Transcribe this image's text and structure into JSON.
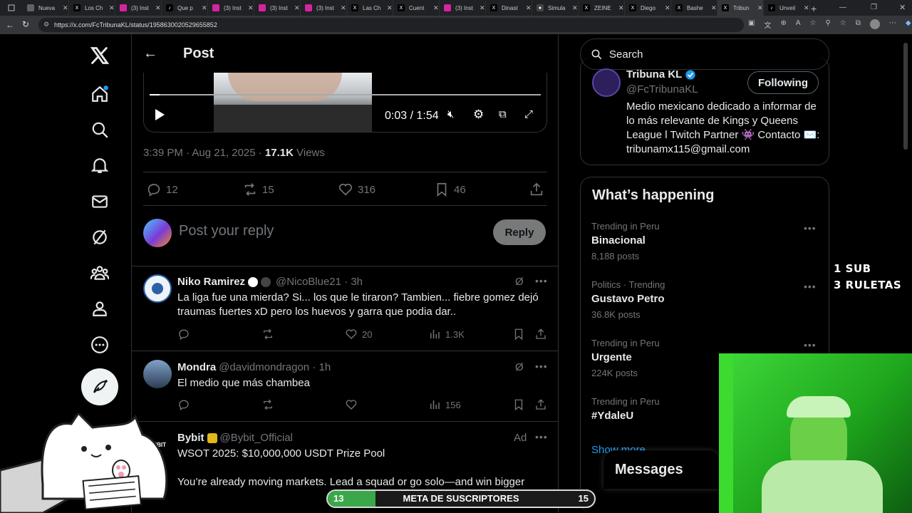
{
  "browser": {
    "tabs": [
      {
        "label": "Nueva",
        "color": "#5f6368",
        "glyph": ""
      },
      {
        "label": "Los Ch",
        "color": "#000000",
        "glyph": "X"
      },
      {
        "label": "(3) Inst",
        "color": "#d6249f",
        "glyph": ""
      },
      {
        "label": "Que p",
        "color": "#000000",
        "glyph": "♪"
      },
      {
        "label": "(3) Inst",
        "color": "#d6249f",
        "glyph": ""
      },
      {
        "label": "(3) Inst",
        "color": "#d6249f",
        "glyph": ""
      },
      {
        "label": "(3) Inst",
        "color": "#d6249f",
        "glyph": ""
      },
      {
        "label": "Las Ch",
        "color": "#000000",
        "glyph": "X"
      },
      {
        "label": "Cuent",
        "color": "#000000",
        "glyph": "X"
      },
      {
        "label": "(3) Inst",
        "color": "#d6249f",
        "glyph": ""
      },
      {
        "label": "Dinast",
        "color": "#000000",
        "glyph": "X"
      },
      {
        "label": "Simula",
        "color": "#444444",
        "glyph": "●"
      },
      {
        "label": "ZEINE",
        "color": "#000000",
        "glyph": "X"
      },
      {
        "label": "Diego",
        "color": "#000000",
        "glyph": "X"
      },
      {
        "label": "Bashe",
        "color": "#000000",
        "glyph": "X"
      },
      {
        "label": "Tribun",
        "color": "#000000",
        "glyph": "X"
      },
      {
        "label": "Unveil",
        "color": "#000000",
        "glyph": "♪"
      }
    ],
    "url": "https://x.com/FcTribunaKL/status/1958630020529655852"
  },
  "header": {
    "title": "Post"
  },
  "video": {
    "time": "0:03 / 1:54"
  },
  "post": {
    "timestamp": "3:39 PM · Aug 21, 2025 · ",
    "views_count": "17.1K",
    "views_label": " Views",
    "replies": "12",
    "reposts": "15",
    "likes": "316",
    "bookmarks": "46"
  },
  "compose": {
    "placeholder": "Post your reply",
    "reply_label": "Reply"
  },
  "replies": [
    {
      "name": "Niko Ramirez",
      "handle": "@NicoBlue21 · 3h",
      "text": "La liga fue una mierda? Si... los que le tiraron? Tambien... fiebre gomez dejó traumas fuertes xD pero los huevos y garra que podia dar..",
      "likes": "20",
      "views": "1.3K"
    },
    {
      "name": "Mondra",
      "handle": "@davidmondragon · 1h",
      "text": "El medio que más chambea",
      "likes": "",
      "views": "156"
    },
    {
      "name": "Bybit",
      "handle": "@Bybit_Official",
      "ad": "Ad",
      "avatar_text": "BYBIT",
      "line1": "WSOT 2025: $10,000,000 USDT Prize Pool",
      "line2": "You’re already moving markets. Lead a squad or go solo—and win bigger"
    }
  ],
  "search": {
    "placeholder": "Search"
  },
  "profile": {
    "name": "Tribuna KL",
    "handle": "@FcTribunaKL",
    "button": "Following",
    "bio": "Medio mexicano dedicado a informar de lo más relevante de Kings y Queens League l Twitch Partner 👾 Contacto ✉️: tribunamx115@gmail.com"
  },
  "trends": {
    "title": "What’s happening",
    "items": [
      {
        "category": "Trending in Peru",
        "name": "Binacional",
        "count": "8,188 posts"
      },
      {
        "category": "Politics · Trending",
        "name": "Gustavo Petro",
        "count": "36.8K posts"
      },
      {
        "category": "Trending in Peru",
        "name": "Urgente",
        "count": "224K posts"
      },
      {
        "category": "Trending in Peru",
        "name": "#YdaleU",
        "count": ""
      }
    ],
    "show_more": "Show more"
  },
  "messages": {
    "label": "Messages"
  },
  "stream": {
    "line1": "1 SUB",
    "line2": "3 RULETAS",
    "goal_current": "13",
    "goal_label": "META DE SUSCRIPTORES",
    "goal_target": "15",
    "goal_progress": 0.18
  },
  "colors": {
    "accent": "#1d9bf0",
    "goal_fill": "#3aa84a",
    "webcam_green": "#2ebd2b"
  }
}
